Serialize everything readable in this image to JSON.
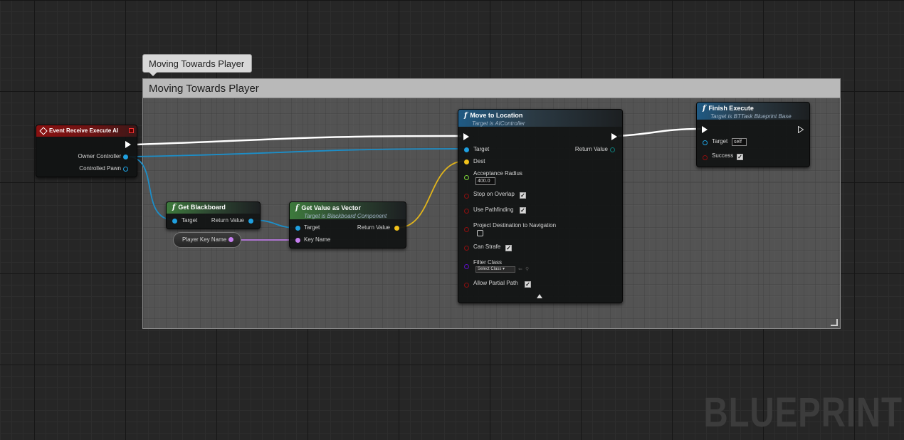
{
  "comment": {
    "bubble": "Moving Towards Player",
    "header": "Moving Towards Player"
  },
  "event_node": {
    "title": "Event Receive Execute AI",
    "pins": {
      "owner": "Owner Controller",
      "pawn": "Controlled Pawn"
    }
  },
  "get_blackboard": {
    "title": "Get Blackboard",
    "pins": {
      "target": "Target",
      "return": "Return Value"
    }
  },
  "player_key_var": {
    "label": "Player Key Name"
  },
  "get_value": {
    "title": "Get Value as Vector",
    "subtitle": "Target is Blackboard Component",
    "pins": {
      "target": "Target",
      "key": "Key Name",
      "return": "Return Value"
    }
  },
  "move_to": {
    "title": "Move to Location",
    "subtitle": "Target is AIController",
    "pins": {
      "target": "Target",
      "dest": "Dest",
      "return": "Return Value",
      "acceptance": "Acceptance Radius",
      "acceptance_value": "400.0",
      "stop_overlap": "Stop on Overlap",
      "use_pathfinding": "Use Pathfinding",
      "project_dest": "Project Destination to Navigation",
      "can_strafe": "Can Strafe",
      "filter_class": "Filter Class",
      "filter_select": "Select Class",
      "allow_partial": "Allow Partial Path"
    },
    "checks": {
      "stop_overlap": true,
      "use_pathfinding": true,
      "project_dest": false,
      "can_strafe": true,
      "allow_partial": true
    }
  },
  "finish": {
    "title": "Finish Execute",
    "subtitle": "Target is BTTask Blueprint Base",
    "pins": {
      "target": "Target",
      "target_value": "self",
      "success": "Success"
    },
    "checks": {
      "success": true
    }
  },
  "watermark": "BLUEPRINT",
  "colors": {
    "exec": "#ffffff",
    "object": "#1fa0e0",
    "vector": "#f2c21b",
    "name": "#c67ff0",
    "float": "#7bd13a",
    "bool": "#8c0f0f",
    "class": "#5a10c0"
  },
  "icons": {
    "function": "function-icon",
    "event": "event-diamond-icon",
    "exec": "exec-arrow-icon",
    "expand": "expand-arrow-icon"
  }
}
